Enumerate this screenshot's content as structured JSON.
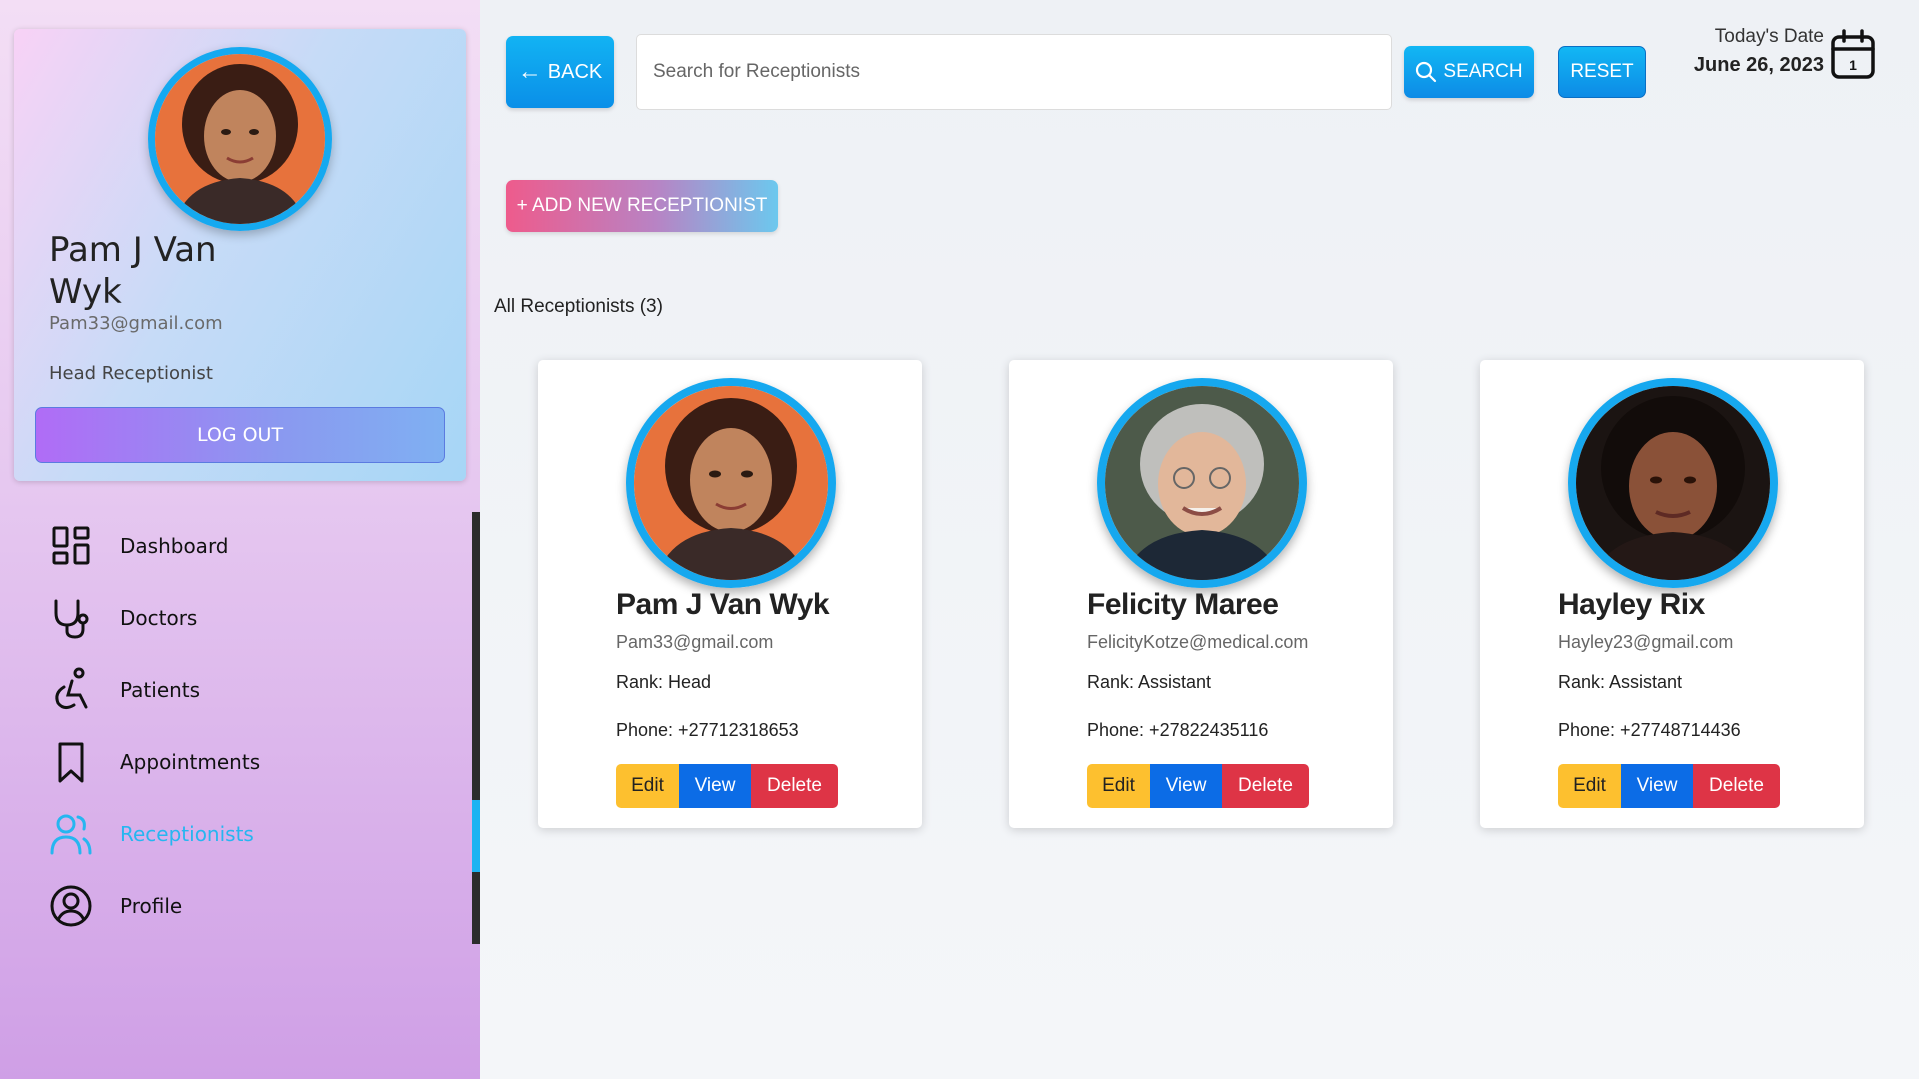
{
  "sidebar": {
    "profile": {
      "name": "Pam J Van Wyk",
      "email": "Pam33@gmail.com",
      "role": "Head Receptionist",
      "logout_label": "LOG OUT"
    },
    "nav": [
      {
        "label": "Dashboard",
        "icon": "dashboard-icon"
      },
      {
        "label": "Doctors",
        "icon": "stethoscope-icon"
      },
      {
        "label": "Patients",
        "icon": "wheelchair-icon"
      },
      {
        "label": "Appointments",
        "icon": "bookmark-icon"
      },
      {
        "label": "Receptionists",
        "icon": "users-icon",
        "active": true
      },
      {
        "label": "Profile",
        "icon": "user-circle-icon"
      }
    ]
  },
  "header": {
    "back_label": "BACK",
    "search_placeholder": "Search for Receptionists",
    "search_label": "SEARCH",
    "reset_label": "RESET",
    "date_label": "Today's Date",
    "date_value": "June 26, 2023",
    "calendar_day": "1"
  },
  "main": {
    "add_label": "+ ADD NEW RECEPTIONIST",
    "list_title": "All Receptionists (3)",
    "receptionists": [
      {
        "name": "Pam J Van Wyk",
        "email": "Pam33@gmail.com",
        "rank": "Rank: Head",
        "phone": "Phone: +27712318653"
      },
      {
        "name": "Felicity Maree",
        "email": "FelicityKotze@medical.com",
        "rank": "Rank: Assistant",
        "phone": "Phone: +27822435116"
      },
      {
        "name": "Hayley Rix",
        "email": "Hayley23@gmail.com",
        "rank": "Rank: Assistant",
        "phone": "Phone: +27748714436"
      }
    ],
    "action_labels": {
      "edit": "Edit",
      "view": "View",
      "delete": "Delete"
    }
  },
  "colors": {
    "accent": "#16a8ef",
    "edit": "#fdc02f",
    "view": "#0c6ce6",
    "delete": "#de3446"
  }
}
